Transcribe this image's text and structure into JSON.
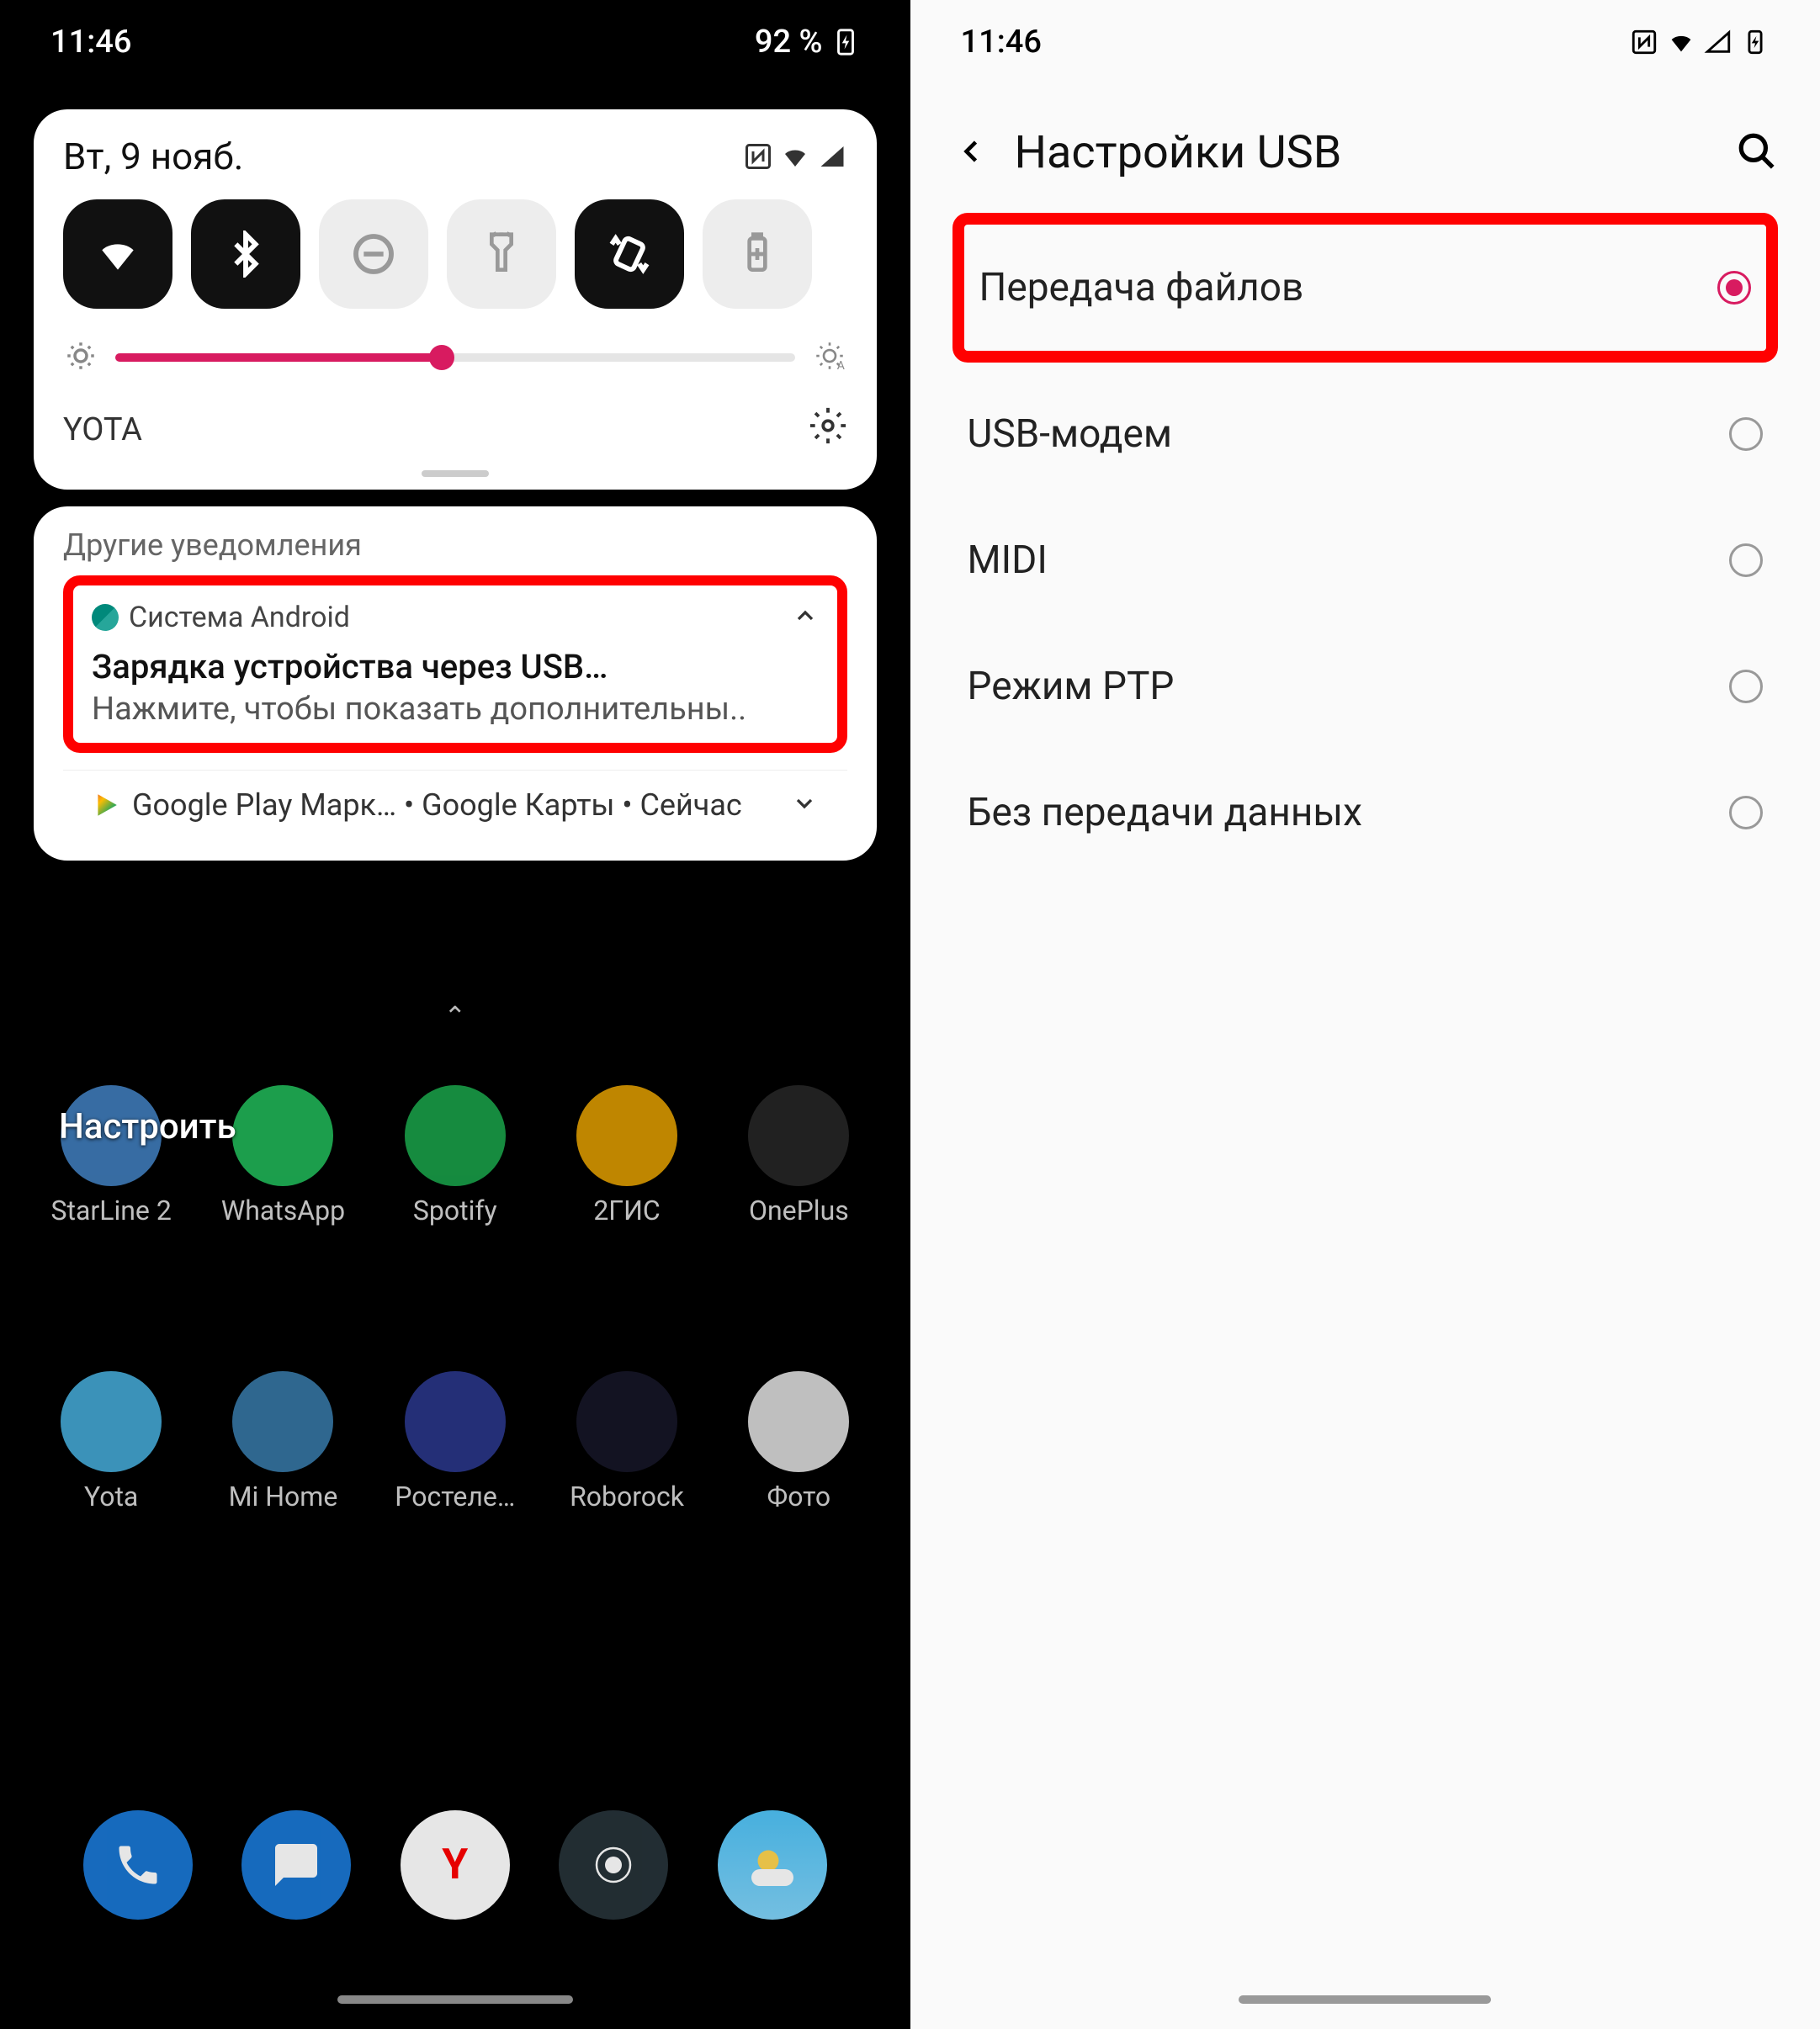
{
  "left": {
    "status": {
      "time": "11:46",
      "battery": "92 %"
    },
    "qs": {
      "date": "Вт, 9 нояб.",
      "carrier": "YOTA",
      "brightness_percent": 48
    },
    "notifs": {
      "section_title": "Другие уведомления",
      "android": {
        "app": "Система Android",
        "title": "Зарядка устройства через USB…",
        "body": "Нажмите, чтобы показать дополнительны.."
      },
      "compact": "Google Play Марк… • Google Карты • Сейчас"
    },
    "home": {
      "configure_label": "Настроить",
      "row1": [
        {
          "label": "StarLine 2",
          "bg": "#4a90d9"
        },
        {
          "label": "WhatsApp",
          "bg": "#25d366"
        },
        {
          "label": "Spotify",
          "bg": "#1db954"
        },
        {
          "label": "2ГИС",
          "bg": "#ffb300"
        },
        {
          "label": "OnePlus",
          "bg": "#2c2c2c"
        }
      ],
      "row2": [
        {
          "label": "Yota",
          "bg": "#4fc3f7"
        },
        {
          "label": "Mi Home",
          "bg": "#3f8abf"
        },
        {
          "label": "Ростеле…",
          "bg": "#303f9f"
        },
        {
          "label": "Roborock",
          "bg": "#1a1a2e"
        },
        {
          "label": "Фото",
          "bg": "#ffffff"
        }
      ]
    }
  },
  "right": {
    "status": {
      "time": "11:46"
    },
    "title": "Настройки USB",
    "options": [
      {
        "label": "Передача файлов",
        "selected": true,
        "highlighted": true
      },
      {
        "label": "USB-модем",
        "selected": false
      },
      {
        "label": "MIDI",
        "selected": false
      },
      {
        "label": "Режим PTP",
        "selected": false
      },
      {
        "label": "Без передачи данных",
        "selected": false
      }
    ]
  }
}
